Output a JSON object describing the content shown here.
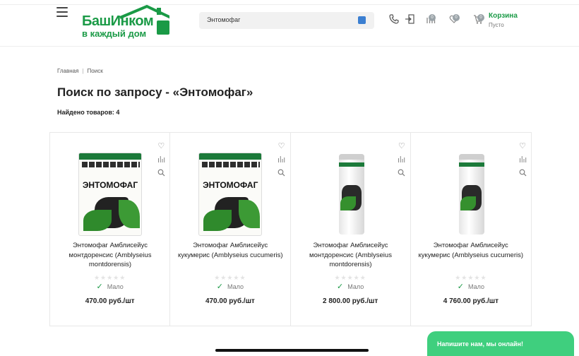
{
  "header": {
    "logo_line1": "БашИнком",
    "logo_line2": "в каждый дом",
    "search_value": "Энтомофаг",
    "compare_count": "0",
    "favorites_count": "0",
    "cart_count": "0",
    "cart_title": "Корзина",
    "cart_status": "Пусто"
  },
  "breadcrumb": {
    "home": "Главная",
    "separator": "|",
    "current": "Поиск"
  },
  "page_title": "Поиск по запросу - «Энтомофаг»",
  "found_text": "Найдено товаров: 4",
  "products": [
    {
      "image_type": "bag",
      "image_label": "ЭНТОМОФАГ",
      "name": "Энтомофаг Амблисейус монтдоренсис (Amblyseius montdorensis)",
      "rating": 0,
      "stock": "Мало",
      "price": "470.00 руб./шт"
    },
    {
      "image_type": "bag",
      "image_label": "ЭНТОМОФАГ",
      "name": "Энтомофаг Амблисейус кукумерис (Amblyseius cucumeris)",
      "rating": 0,
      "stock": "Мало",
      "price": "470.00 руб./шт"
    },
    {
      "image_type": "tube",
      "image_label": "",
      "name": "Энтомофаг Амблисейус монтдоренсис (Amblyseius montdorensis)",
      "rating": 0,
      "stock": "Мало",
      "price": "2 800.00 руб./шт"
    },
    {
      "image_type": "tube",
      "image_label": "",
      "name": "Энтомофаг Амблисейус кукумерис (Amblyseius cucumeris)",
      "rating": 0,
      "stock": "Мало",
      "price": "4 760.00 руб./шт"
    }
  ],
  "icons": {
    "menu": "hamburger-icon",
    "phone": "phone-icon",
    "login": "login-icon",
    "compare": "compare-icon",
    "favorites": "heart-icon",
    "cart": "cart-icon",
    "search": "search-icon",
    "product_favorite": "heart-icon",
    "product_compare": "compare-icon",
    "product_quickview": "magnifier-icon",
    "in_stock": "check-icon",
    "rating": "star-icon"
  },
  "chat_label": "Напишите нам, мы онлайн!",
  "colors": {
    "brand_green": "#1a9a46",
    "chat_green": "#3fcf7e",
    "search_button": "#3b7fd1"
  }
}
